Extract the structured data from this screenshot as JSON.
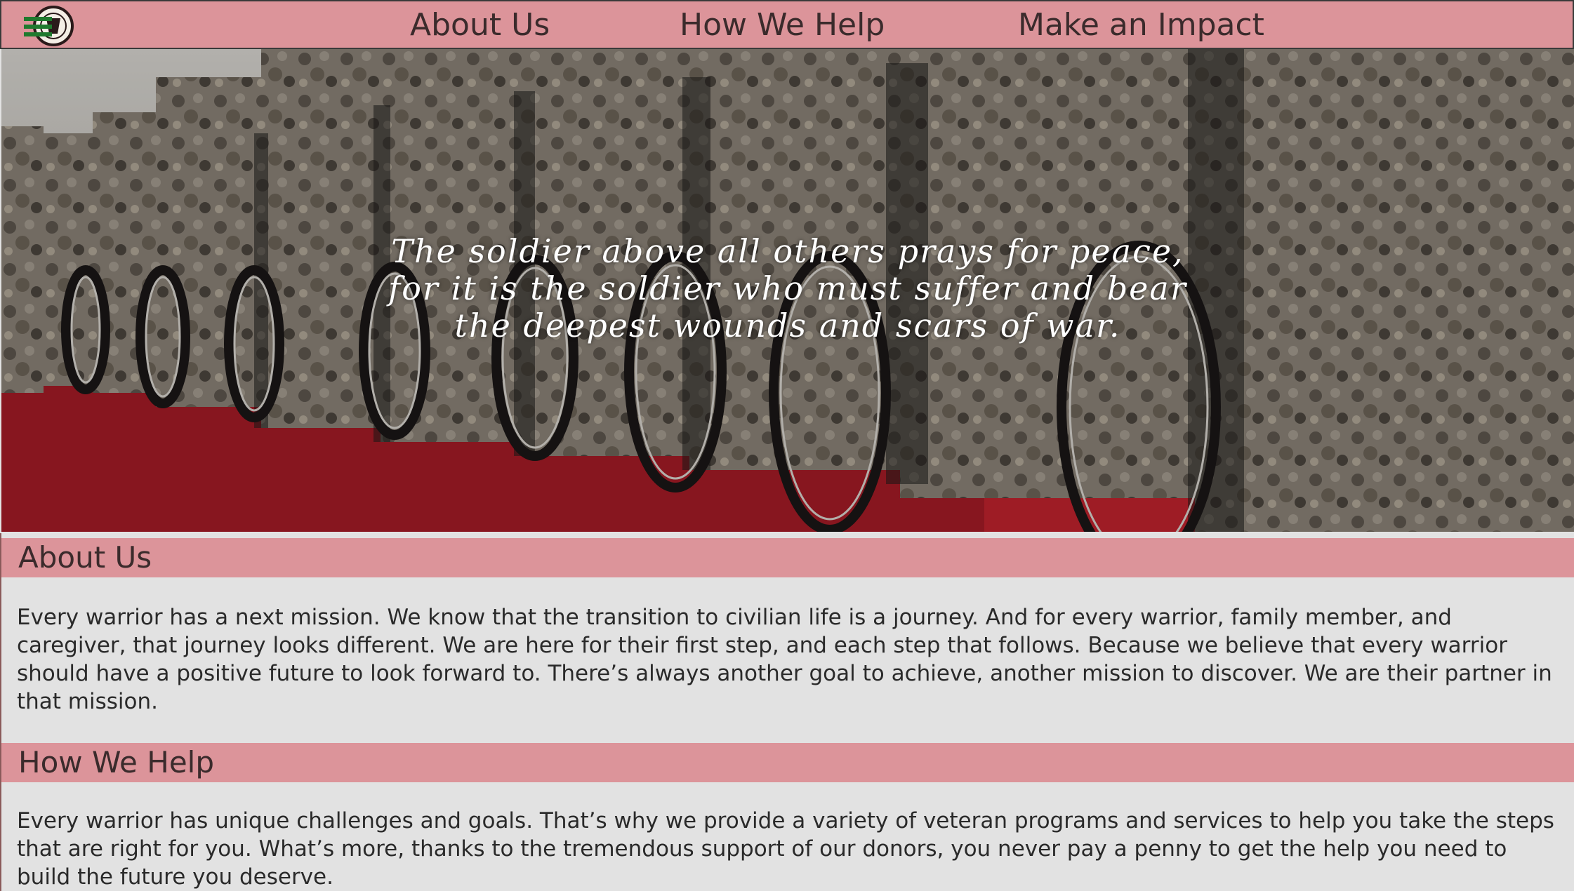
{
  "nav": {
    "logo_icon": "wounded-warrior-project-logo",
    "links": [
      "About Us",
      "How We Help",
      "Make an Impact"
    ]
  },
  "hero": {
    "quote_lines": [
      "The soldier above all others prays for peace,",
      "for it is the soldier who must suffer and bear",
      "the deepest wounds and scars of war."
    ]
  },
  "sections": [
    {
      "title": "About Us",
      "body_lines": [
        "Every warrior has a next mission. We know that the transition to civilian life is a journey. And for every warrior, family member, and",
        "caregiver, that journey looks different. We are here for their first step, and each step that follows. Because we believe that every warrior",
        "should have a positive future to look forward to. There’s always another goal to achieve, another mission to discover. We are their partner in",
        "that mission."
      ]
    },
    {
      "title": "How We Help",
      "body_lines": [
        "Every warrior has unique challenges and goals. That’s why we provide a variety of veteran programs and services to help you take the steps",
        "that are right for you. What’s more, thanks to the tremendous support of our donors, you never pay a penny to get the help you need to",
        "build the future you deserve."
      ]
    }
  ],
  "colors": {
    "bar_pink": "#dc949a",
    "page_bg": "#e2e2e2",
    "logo_green": "#1f7a2e"
  }
}
